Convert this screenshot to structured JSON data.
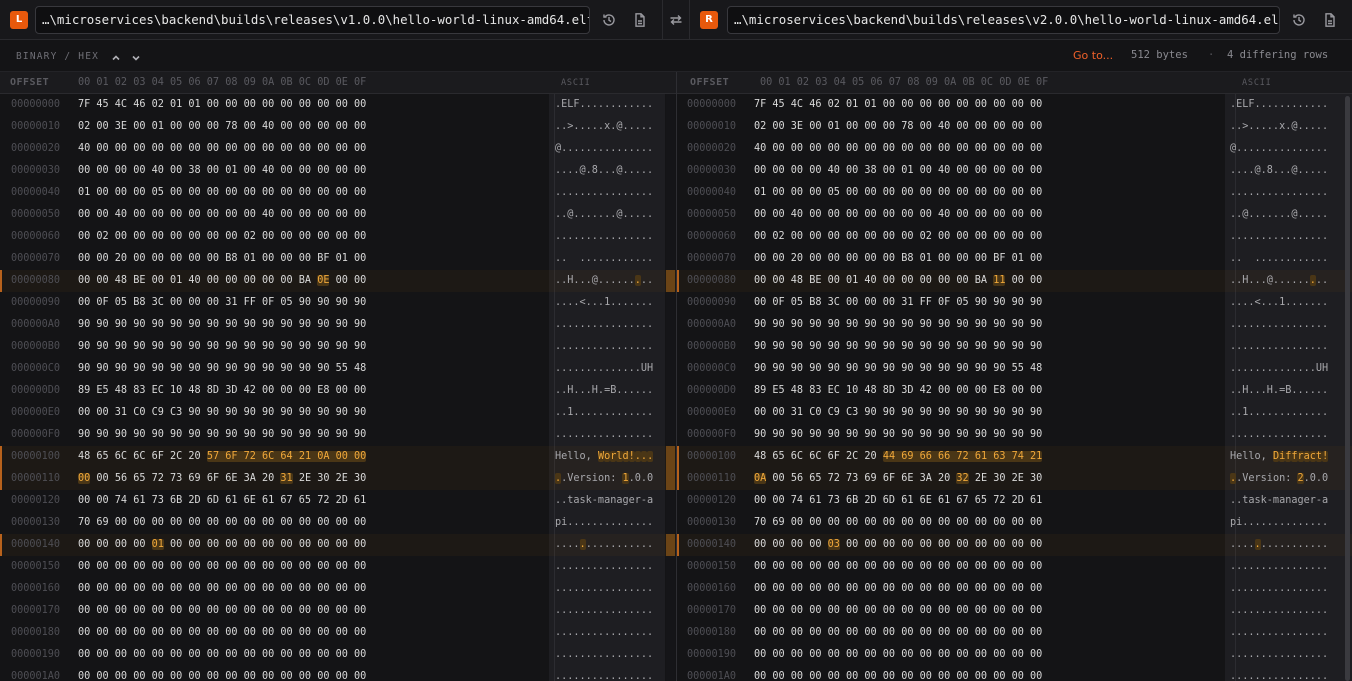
{
  "files": {
    "left": {
      "badge": "L",
      "path": "…\\microservices\\backend\\builds\\releases\\v1.0.0\\hello-world-linux-amd64.elf"
    },
    "right": {
      "badge": "R",
      "path": "…\\microservices\\backend\\builds\\releases\\v2.0.0\\hello-world-linux-amd64.elf"
    }
  },
  "icons": {
    "history": "history-icon",
    "document": "document-icon",
    "swap": "swap-icon",
    "chevron_up": "chevron-up-icon",
    "chevron_down": "chevron-down-icon"
  },
  "toolbar": {
    "mode": "BINARY / HEX",
    "goto": "Go to...",
    "size": "512 bytes",
    "separator": "·",
    "diff_summary": "4 differing rows"
  },
  "header": {
    "offset": "OFFSET",
    "columns": "00 01 02 03 04 05 06 07 08 09 0A 0B 0C 0D 0E 0F",
    "ascii": "ASCII"
  },
  "colors": {
    "accent": "#f0612a",
    "badge": "#e8590c",
    "highlight_bg": "#4a3616",
    "highlight_fg": "#f0a83a"
  },
  "left_rows": [
    {
      "offset": "00000000",
      "bytes": "7F 45 4C 46 02 01 01 00 00 00 00 00 00 00 00 00",
      "ascii": ".ELF............",
      "diff": [],
      "adiff": []
    },
    {
      "offset": "00000010",
      "bytes": "02 00 3E 00 01 00 00 00 78 00 40 00 00 00 00 00",
      "ascii": "..>.....x.@.....",
      "diff": [],
      "adiff": []
    },
    {
      "offset": "00000020",
      "bytes": "40 00 00 00 00 00 00 00 00 00 00 00 00 00 00 00",
      "ascii": "@...............",
      "diff": [],
      "adiff": []
    },
    {
      "offset": "00000030",
      "bytes": "00 00 00 00 40 00 38 00 01 00 40 00 00 00 00 00",
      "ascii": "....@.8...@.....",
      "diff": [],
      "adiff": []
    },
    {
      "offset": "00000040",
      "bytes": "01 00 00 00 05 00 00 00 00 00 00 00 00 00 00 00",
      "ascii": "................",
      "diff": [],
      "adiff": []
    },
    {
      "offset": "00000050",
      "bytes": "00 00 40 00 00 00 00 00 00 00 40 00 00 00 00 00",
      "ascii": "..@.......@.....",
      "diff": [],
      "adiff": []
    },
    {
      "offset": "00000060",
      "bytes": "00 02 00 00 00 00 00 00 00 02 00 00 00 00 00 00",
      "ascii": "................",
      "diff": [],
      "adiff": []
    },
    {
      "offset": "00000070",
      "bytes": "00 00 20 00 00 00 00 00 B8 01 00 00 00 BF 01 00",
      "ascii": "..  ............",
      "diff": [],
      "adiff": []
    },
    {
      "offset": "00000080",
      "bytes": "00 00 48 BE 00 01 40 00 00 00 00 00 BA 0E 00 00",
      "ascii": "..H...@.........",
      "diff": [
        13
      ],
      "adiff": [
        13
      ]
    },
    {
      "offset": "00000090",
      "bytes": "00 0F 05 B8 3C 00 00 00 31 FF 0F 05 90 90 90 90",
      "ascii": "....<...1.......",
      "diff": [],
      "adiff": []
    },
    {
      "offset": "000000A0",
      "bytes": "90 90 90 90 90 90 90 90 90 90 90 90 90 90 90 90",
      "ascii": "................",
      "diff": [],
      "adiff": []
    },
    {
      "offset": "000000B0",
      "bytes": "90 90 90 90 90 90 90 90 90 90 90 90 90 90 90 90",
      "ascii": "................",
      "diff": [],
      "adiff": []
    },
    {
      "offset": "000000C0",
      "bytes": "90 90 90 90 90 90 90 90 90 90 90 90 90 90 55 48",
      "ascii": "..............UH",
      "diff": [],
      "adiff": []
    },
    {
      "offset": "000000D0",
      "bytes": "89 E5 48 83 EC 10 48 8D 3D 42 00 00 00 E8 00 00",
      "ascii": "..H...H.=B......",
      "diff": [],
      "adiff": []
    },
    {
      "offset": "000000E0",
      "bytes": "00 00 31 C0 C9 C3 90 90 90 90 90 90 90 90 90 90",
      "ascii": "..1.............",
      "diff": [],
      "adiff": []
    },
    {
      "offset": "000000F0",
      "bytes": "90 90 90 90 90 90 90 90 90 90 90 90 90 90 90 90",
      "ascii": "................",
      "diff": [],
      "adiff": []
    },
    {
      "offset": "00000100",
      "bytes": "48 65 6C 6C 6F 2C 20 57 6F 72 6C 64 21 0A 00 00",
      "ascii": "Hello, World!...",
      "diff": [
        7,
        8,
        9,
        10,
        11,
        12,
        13,
        14,
        15
      ],
      "adiff": [
        7,
        8,
        9,
        10,
        11,
        12,
        13,
        14,
        15
      ]
    },
    {
      "offset": "00000110",
      "bytes": "00 00 56 65 72 73 69 6F 6E 3A 20 31 2E 30 2E 30",
      "ascii": "..Version: 1.0.0",
      "diff": [
        0,
        11
      ],
      "adiff": [
        0,
        11
      ]
    },
    {
      "offset": "00000120",
      "bytes": "00 00 74 61 73 6B 2D 6D 61 6E 61 67 65 72 2D 61",
      "ascii": "..task-manager-a",
      "diff": [],
      "adiff": []
    },
    {
      "offset": "00000130",
      "bytes": "70 69 00 00 00 00 00 00 00 00 00 00 00 00 00 00",
      "ascii": "pi..............",
      "diff": [],
      "adiff": []
    },
    {
      "offset": "00000140",
      "bytes": "00 00 00 00 01 00 00 00 00 00 00 00 00 00 00 00",
      "ascii": "................",
      "diff": [
        4
      ],
      "adiff": [
        4
      ]
    },
    {
      "offset": "00000150",
      "bytes": "00 00 00 00 00 00 00 00 00 00 00 00 00 00 00 00",
      "ascii": "................",
      "diff": [],
      "adiff": []
    },
    {
      "offset": "00000160",
      "bytes": "00 00 00 00 00 00 00 00 00 00 00 00 00 00 00 00",
      "ascii": "................",
      "diff": [],
      "adiff": []
    },
    {
      "offset": "00000170",
      "bytes": "00 00 00 00 00 00 00 00 00 00 00 00 00 00 00 00",
      "ascii": "................",
      "diff": [],
      "adiff": []
    },
    {
      "offset": "00000180",
      "bytes": "00 00 00 00 00 00 00 00 00 00 00 00 00 00 00 00",
      "ascii": "................",
      "diff": [],
      "adiff": []
    },
    {
      "offset": "00000190",
      "bytes": "00 00 00 00 00 00 00 00 00 00 00 00 00 00 00 00",
      "ascii": "................",
      "diff": [],
      "adiff": []
    },
    {
      "offset": "000001A0",
      "bytes": "00 00 00 00 00 00 00 00 00 00 00 00 00 00 00 00",
      "ascii": "................",
      "diff": [],
      "adiff": []
    }
  ],
  "right_rows": [
    {
      "offset": "00000000",
      "bytes": "7F 45 4C 46 02 01 01 00 00 00 00 00 00 00 00 00",
      "ascii": ".ELF............",
      "diff": [],
      "adiff": []
    },
    {
      "offset": "00000010",
      "bytes": "02 00 3E 00 01 00 00 00 78 00 40 00 00 00 00 00",
      "ascii": "..>.....x.@.....",
      "diff": [],
      "adiff": []
    },
    {
      "offset": "00000020",
      "bytes": "40 00 00 00 00 00 00 00 00 00 00 00 00 00 00 00",
      "ascii": "@...............",
      "diff": [],
      "adiff": []
    },
    {
      "offset": "00000030",
      "bytes": "00 00 00 00 40 00 38 00 01 00 40 00 00 00 00 00",
      "ascii": "....@.8...@.....",
      "diff": [],
      "adiff": []
    },
    {
      "offset": "00000040",
      "bytes": "01 00 00 00 05 00 00 00 00 00 00 00 00 00 00 00",
      "ascii": "................",
      "diff": [],
      "adiff": []
    },
    {
      "offset": "00000050",
      "bytes": "00 00 40 00 00 00 00 00 00 00 40 00 00 00 00 00",
      "ascii": "..@.......@.....",
      "diff": [],
      "adiff": []
    },
    {
      "offset": "00000060",
      "bytes": "00 02 00 00 00 00 00 00 00 02 00 00 00 00 00 00",
      "ascii": "................",
      "diff": [],
      "adiff": []
    },
    {
      "offset": "00000070",
      "bytes": "00 00 20 00 00 00 00 00 B8 01 00 00 00 BF 01 00",
      "ascii": "..  ............",
      "diff": [],
      "adiff": []
    },
    {
      "offset": "00000080",
      "bytes": "00 00 48 BE 00 01 40 00 00 00 00 00 BA 11 00 00",
      "ascii": "..H...@.........",
      "diff": [
        13
      ],
      "adiff": [
        13
      ]
    },
    {
      "offset": "00000090",
      "bytes": "00 0F 05 B8 3C 00 00 00 31 FF 0F 05 90 90 90 90",
      "ascii": "....<...1.......",
      "diff": [],
      "adiff": []
    },
    {
      "offset": "000000A0",
      "bytes": "90 90 90 90 90 90 90 90 90 90 90 90 90 90 90 90",
      "ascii": "................",
      "diff": [],
      "adiff": []
    },
    {
      "offset": "000000B0",
      "bytes": "90 90 90 90 90 90 90 90 90 90 90 90 90 90 90 90",
      "ascii": "................",
      "diff": [],
      "adiff": []
    },
    {
      "offset": "000000C0",
      "bytes": "90 90 90 90 90 90 90 90 90 90 90 90 90 90 55 48",
      "ascii": "..............UH",
      "diff": [],
      "adiff": []
    },
    {
      "offset": "000000D0",
      "bytes": "89 E5 48 83 EC 10 48 8D 3D 42 00 00 00 E8 00 00",
      "ascii": "..H...H.=B......",
      "diff": [],
      "adiff": []
    },
    {
      "offset": "000000E0",
      "bytes": "00 00 31 C0 C9 C3 90 90 90 90 90 90 90 90 90 90",
      "ascii": "..1.............",
      "diff": [],
      "adiff": []
    },
    {
      "offset": "000000F0",
      "bytes": "90 90 90 90 90 90 90 90 90 90 90 90 90 90 90 90",
      "ascii": "................",
      "diff": [],
      "adiff": []
    },
    {
      "offset": "00000100",
      "bytes": "48 65 6C 6C 6F 2C 20 44 69 66 66 72 61 63 74 21",
      "ascii": "Hello, Diffract!",
      "diff": [
        7,
        8,
        9,
        10,
        11,
        12,
        13,
        14,
        15
      ],
      "adiff": [
        7,
        8,
        9,
        10,
        11,
        12,
        13,
        14,
        15
      ]
    },
    {
      "offset": "00000110",
      "bytes": "0A 00 56 65 72 73 69 6F 6E 3A 20 32 2E 30 2E 30",
      "ascii": "..Version: 2.0.0",
      "diff": [
        0,
        11
      ],
      "adiff": [
        0,
        11
      ]
    },
    {
      "offset": "00000120",
      "bytes": "00 00 74 61 73 6B 2D 6D 61 6E 61 67 65 72 2D 61",
      "ascii": "..task-manager-a",
      "diff": [],
      "adiff": []
    },
    {
      "offset": "00000130",
      "bytes": "70 69 00 00 00 00 00 00 00 00 00 00 00 00 00 00",
      "ascii": "pi..............",
      "diff": [],
      "adiff": []
    },
    {
      "offset": "00000140",
      "bytes": "00 00 00 00 03 00 00 00 00 00 00 00 00 00 00 00",
      "ascii": "................",
      "diff": [
        4
      ],
      "adiff": [
        4
      ]
    },
    {
      "offset": "00000150",
      "bytes": "00 00 00 00 00 00 00 00 00 00 00 00 00 00 00 00",
      "ascii": "................",
      "diff": [],
      "adiff": []
    },
    {
      "offset": "00000160",
      "bytes": "00 00 00 00 00 00 00 00 00 00 00 00 00 00 00 00",
      "ascii": "................",
      "diff": [],
      "adiff": []
    },
    {
      "offset": "00000170",
      "bytes": "00 00 00 00 00 00 00 00 00 00 00 00 00 00 00 00",
      "ascii": "................",
      "diff": [],
      "adiff": []
    },
    {
      "offset": "00000180",
      "bytes": "00 00 00 00 00 00 00 00 00 00 00 00 00 00 00 00",
      "ascii": "................",
      "diff": [],
      "adiff": []
    },
    {
      "offset": "00000190",
      "bytes": "00 00 00 00 00 00 00 00 00 00 00 00 00 00 00 00",
      "ascii": "................",
      "diff": [],
      "adiff": []
    },
    {
      "offset": "000001A0",
      "bytes": "00 00 00 00 00 00 00 00 00 00 00 00 00 00 00 00",
      "ascii": "................",
      "diff": [],
      "adiff": []
    }
  ]
}
